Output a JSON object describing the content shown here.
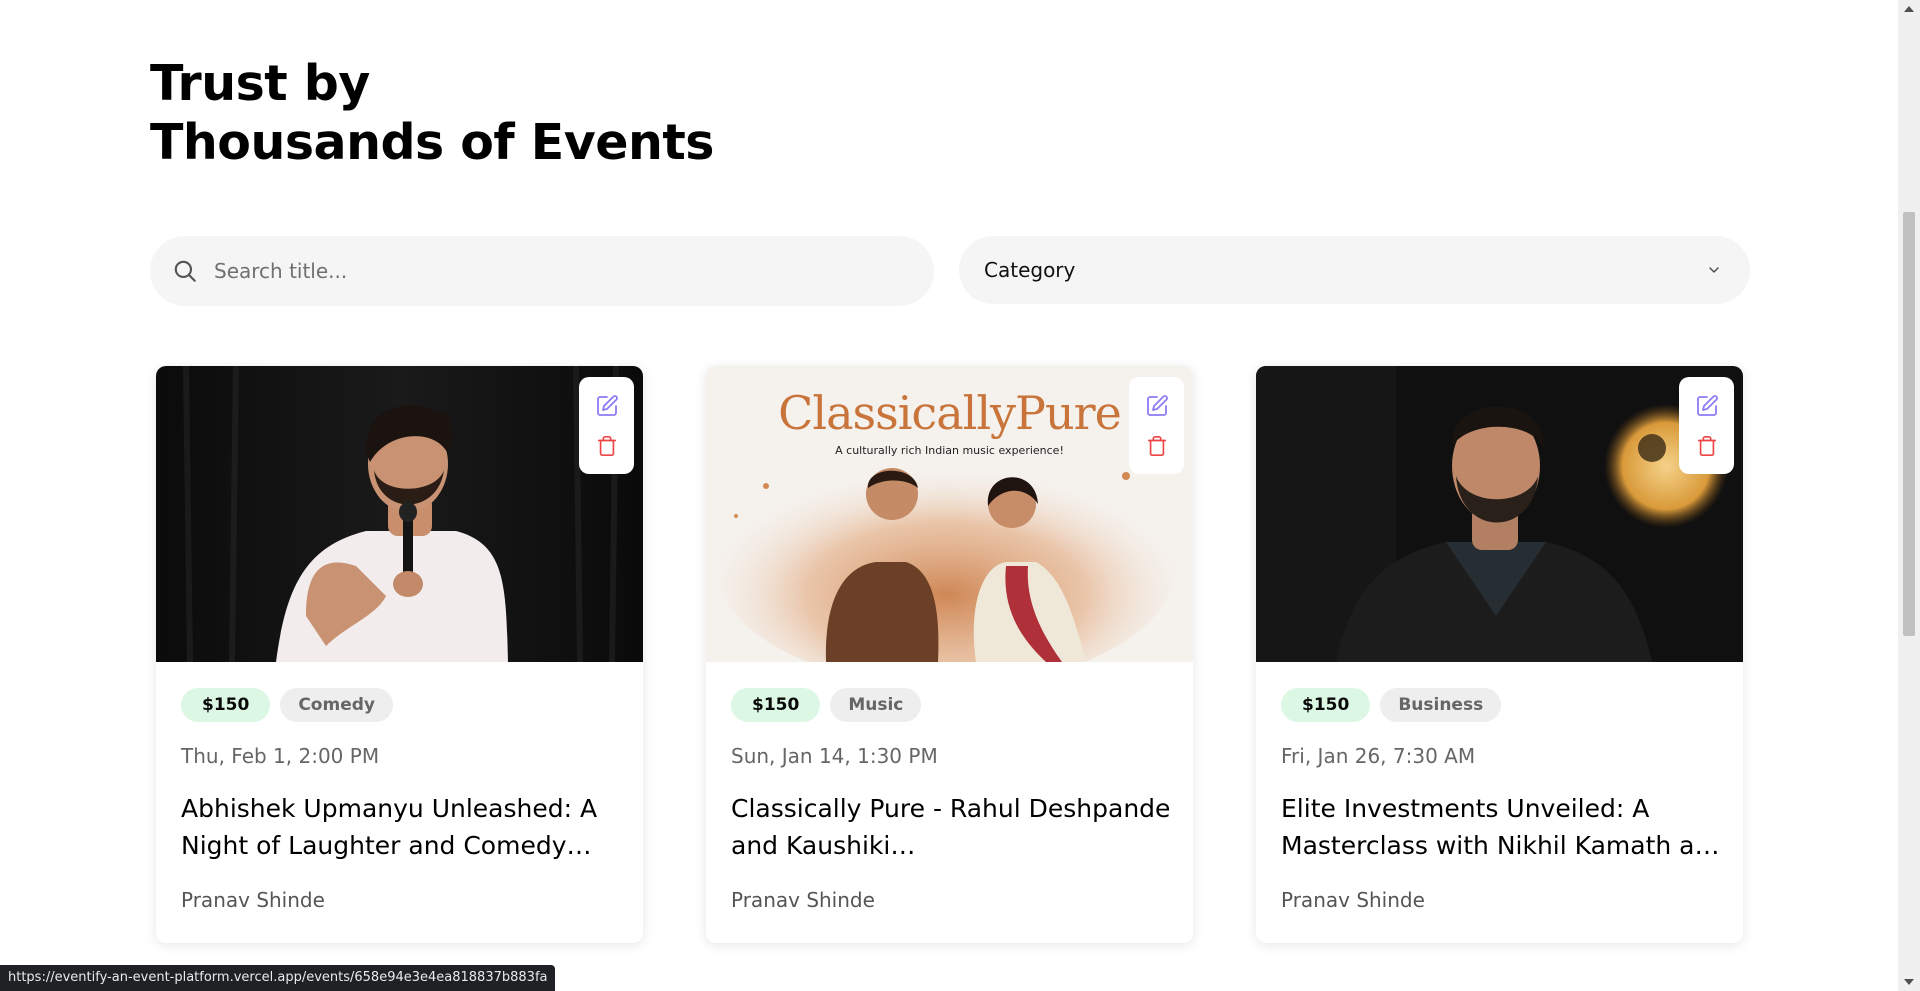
{
  "heading": {
    "line1": "Trust by",
    "line2": "Thousands of Events"
  },
  "search": {
    "placeholder": "Search title..."
  },
  "category_select": {
    "selected": "Category"
  },
  "events": [
    {
      "price": "$150",
      "category": "Comedy",
      "date": "Thu, Feb 1, 2:00 PM",
      "title": "Abhishek Upmanyu Unleashed: A Night of Laughter and Comedy…",
      "organizer": "Pranav Shinde"
    },
    {
      "price": "$150",
      "category": "Music",
      "date": "Sun, Jan 14, 1:30 PM",
      "title": "Classically Pure - Rahul Deshpande and Kaushiki…",
      "organizer": "Pranav Shinde",
      "poster_title": "ClassicallyPure",
      "poster_subtitle": "A culturally rich Indian music experience!"
    },
    {
      "price": "$150",
      "category": "Business",
      "date": "Fri, Jan 26, 7:30 AM",
      "title": "Elite Investments Unveiled: A Masterclass with Nikhil Kamath a…",
      "organizer": "Pranav Shinde"
    }
  ],
  "status_url": "https://eventify-an-event-platform.vercel.app/events/658e94e3e4ea818837b883fa",
  "colors": {
    "edit_icon": "#8b7cf6",
    "delete_icon": "#ef4444",
    "price_badge_bg": "#dcf8e4",
    "category_badge_bg": "#eeeeee"
  },
  "icons": [
    "search-icon",
    "chevron-down-icon",
    "edit-icon",
    "trash-icon"
  ]
}
